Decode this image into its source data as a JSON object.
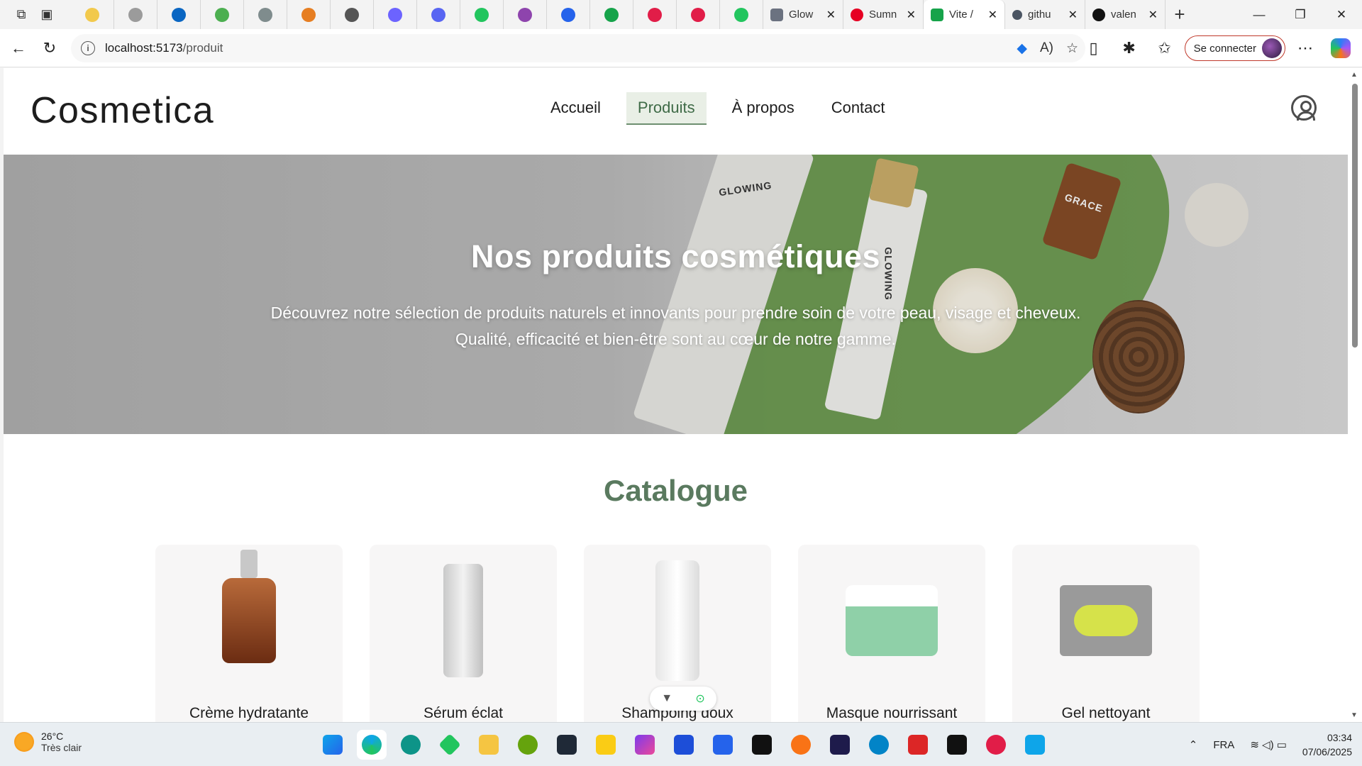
{
  "browser": {
    "pinned_tab_colors": [
      "#f2c94c",
      "#9b9b9b",
      "#0a66c2",
      "#4caf50",
      "#7f8c8d",
      "#e67e22",
      "#555555",
      "#6c63ff",
      "#5865f2",
      "#22c55e",
      "#8e44ad",
      "#2563eb",
      "#16a34a",
      "#e11d48",
      "#e11d48",
      "#22c55e"
    ],
    "tabs": [
      {
        "label": "Glow",
        "favicon_color": "#6b7280"
      },
      {
        "label": "Sumn",
        "favicon_color": "#e60023"
      },
      {
        "label": "Vite /",
        "favicon_color": "#16a34a",
        "active": true
      },
      {
        "label": "githu",
        "favicon_color": "#4b5563"
      },
      {
        "label": "valen",
        "favicon_color": "#111111"
      }
    ],
    "url_host": "localhost:5173",
    "url_path": "/produit",
    "sign_in_label": "Se connecter"
  },
  "site": {
    "logo": "Cosmetica",
    "nav": [
      {
        "label": "Accueil"
      },
      {
        "label": "Produits",
        "active": true
      },
      {
        "label": "À propos"
      },
      {
        "label": "Contact"
      }
    ],
    "hero_title": "Nos produits cosmétiques",
    "hero_line1": "Découvrez notre sélection de produits naturels et innovants pour prendre soin de votre peau, visage et cheveux.",
    "hero_line2": "Qualité, efficacité et bien-être sont au cœur de notre gamme.",
    "hero_brand_marks": [
      "GLOWING",
      "GLOWING",
      "GRACE"
    ],
    "catalogue_title": "Catalogue",
    "products": [
      {
        "name": "Crème hydratante"
      },
      {
        "name": "Sérum éclat"
      },
      {
        "name": "Shampoing doux"
      },
      {
        "name": "Masque nourrissant"
      },
      {
        "name": "Gel nettoyant"
      }
    ],
    "accent_color": "#5a7a5f"
  },
  "taskbar": {
    "temperature": "26°C",
    "weather": "Très clair",
    "language": "FRA",
    "time": "03:34",
    "date": "07/06/2025"
  }
}
